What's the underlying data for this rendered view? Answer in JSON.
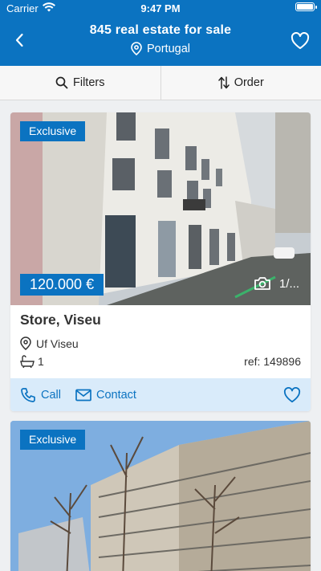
{
  "status_bar": {
    "carrier": "Carrier",
    "time": "9:47 PM"
  },
  "header": {
    "title": "845 real estate for sale",
    "subtitle": "Portugal"
  },
  "toolbar": {
    "filters_label": "Filters",
    "order_label": "Order"
  },
  "listings": [
    {
      "badge": "Exclusive",
      "price": "120.000 €",
      "photo_count": "1/...",
      "name": "Store, Viseu",
      "location": "Uf Viseu",
      "bathrooms": "1",
      "ref": "ref: 149896",
      "call_label": "Call",
      "contact_label": "Contact"
    },
    {
      "badge": "Exclusive"
    }
  ],
  "colors": {
    "brand": "#0b73c1",
    "action_bar": "#d9ebfa"
  },
  "icons": [
    "wifi-icon",
    "battery-icon",
    "back-arrow-icon",
    "heart-icon",
    "location-pin-icon",
    "search-icon",
    "sort-icon",
    "camera-icon",
    "bathtub-icon",
    "phone-icon",
    "mail-icon"
  ]
}
